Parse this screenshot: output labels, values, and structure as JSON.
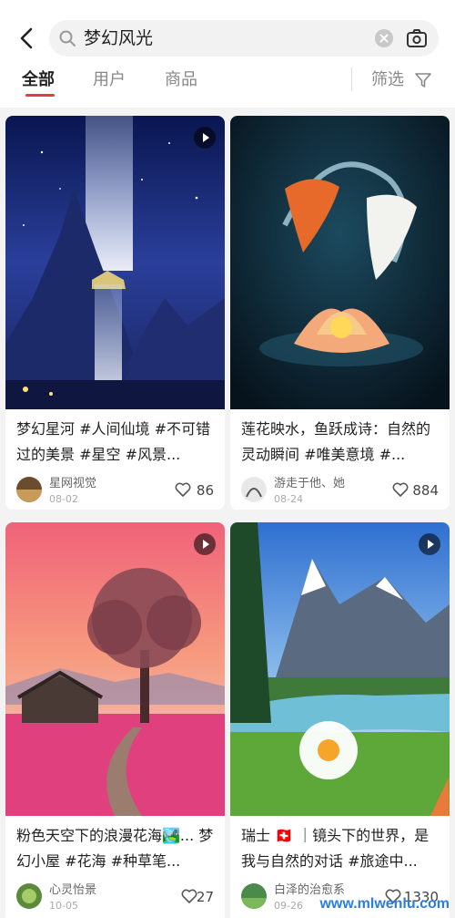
{
  "search": {
    "query": "梦幻风光"
  },
  "tabs": [
    {
      "label": "全部"
    },
    {
      "label": "用户"
    },
    {
      "label": "商品"
    }
  ],
  "filter_label": "筛选",
  "accent_color": "#e33b43",
  "cards": [
    {
      "title": "梦幻星河 #人间仙境 #不可错过的美景 #星空 #风景...",
      "author": "星网视觉",
      "date": "08-02",
      "likes": "86",
      "has_video": true
    },
    {
      "title": "莲花映水，鱼跃成诗：自然的灵动瞬间 #唯美意境 #...",
      "author": "游走于他、她",
      "date": "08-24",
      "likes": "884",
      "has_video": false
    },
    {
      "title": "粉色天空下的浪漫花海🏞️... 梦幻小屋 #花海 #种草笔...",
      "author": "心灵怡景",
      "date": "10-05",
      "likes": "27",
      "has_video": true
    },
    {
      "title": "瑞士 🇨🇭 ｜镜头下的世界，是我与自然的对话 #旅途中...",
      "author": "白泽的治愈系",
      "date": "09-26",
      "likes": "1330",
      "has_video": true
    }
  ],
  "watermark": "www.mlwenlu.com"
}
